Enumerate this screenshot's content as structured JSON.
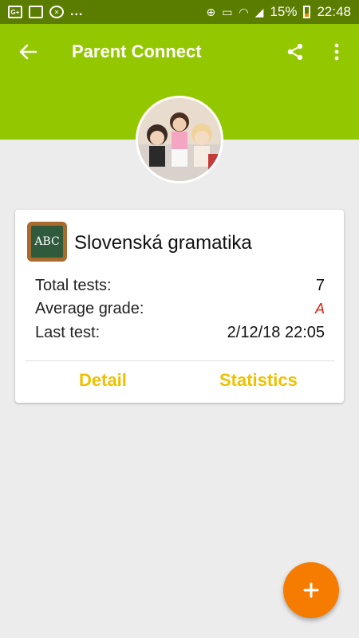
{
  "status_bar": {
    "icons": [
      "google-plus-icon",
      "gallery-icon",
      "xbox-icon"
    ],
    "overflow": "...",
    "battery": "15%",
    "time": "22:48"
  },
  "app_bar": {
    "title": "Parent Connect",
    "back_icon": "arrow-left-icon",
    "share_icon": "share-icon",
    "menu_icon": "more-vert-icon",
    "background_color": "#93c800"
  },
  "subject_card": {
    "subject": "Slovenská gramatika",
    "icon_text": "ABC",
    "stats": [
      {
        "label": "Total tests:",
        "value": "7"
      },
      {
        "label": "Average grade:",
        "value": "A"
      },
      {
        "label": "Last test:",
        "value": "2/12/18 22:05"
      }
    ],
    "actions": {
      "detail": "Detail",
      "statistics": "Statistics"
    },
    "action_color": "#efc000"
  },
  "fab": {
    "label": "+",
    "color": "#f57c00"
  }
}
